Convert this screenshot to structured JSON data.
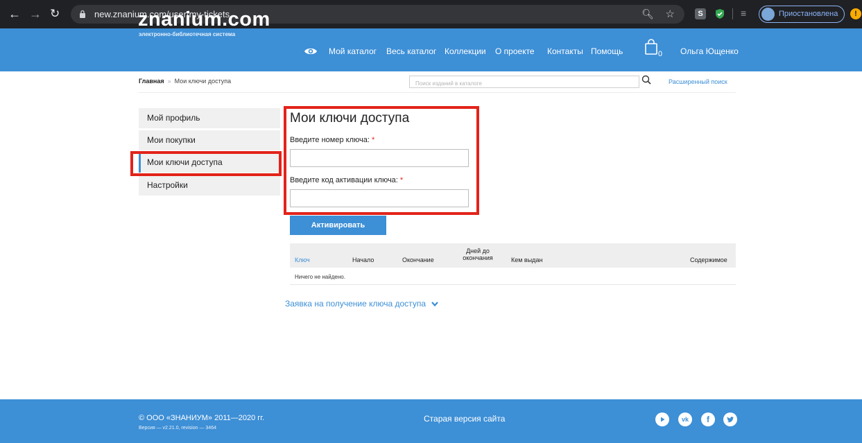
{
  "browser": {
    "url": "new.znanium.com/user/my-tickets",
    "profile_status": "Приостановлена",
    "ext_s_label": "S"
  },
  "header": {
    "logo_main": "znanium.com",
    "logo_sub": "электронно-библиотечная система",
    "nav": [
      "Мой каталог",
      "Весь каталог",
      "Коллекции",
      "О проекте",
      "Контакты",
      "Помощь"
    ],
    "cart_count": "0",
    "user_name": "Ольга Ющенко"
  },
  "breadcrumb": {
    "home": "Главная",
    "separator": "»",
    "current": "Мои ключи доступа"
  },
  "search": {
    "placeholder": "Поиск изданий в каталоге",
    "advanced_link": "Расширенный поиск"
  },
  "sidebar": {
    "items": [
      {
        "label": "Мой профиль"
      },
      {
        "label": "Мои покупки"
      },
      {
        "label": "Мои ключи доступа",
        "active": true
      },
      {
        "label": "Настройки"
      }
    ]
  },
  "form": {
    "title": "Мои ключи доступа",
    "key_label": "Введите номер ключа:",
    "code_label": "Введите код активации ключа:",
    "required_mark": "*",
    "key_value": "",
    "code_value": "",
    "submit_label": "Активировать"
  },
  "table": {
    "headers": [
      "Ключ",
      "Начало",
      "Окончание",
      "Дней до окончания",
      "Кем выдан",
      "Содержимое"
    ],
    "header_days_line1": "Дней до",
    "header_days_line2": "окончания",
    "empty_message": "Ничего не найдено."
  },
  "request_link": "Заявка на получение ключа доступа",
  "footer": {
    "copyright": "© ООО «ЗНАНИУМ» 2011—2020 гг.",
    "version": "Версия — v2.21.0, revision — 3464",
    "old_site": "Старая версия сайта",
    "social": [
      "youtube-icon",
      "vk-icon",
      "facebook-icon",
      "twitter-icon"
    ]
  },
  "colors": {
    "brand_blue": "#3d8fd6",
    "highlight_red": "#e2231a",
    "chrome_dark": "#202124"
  }
}
